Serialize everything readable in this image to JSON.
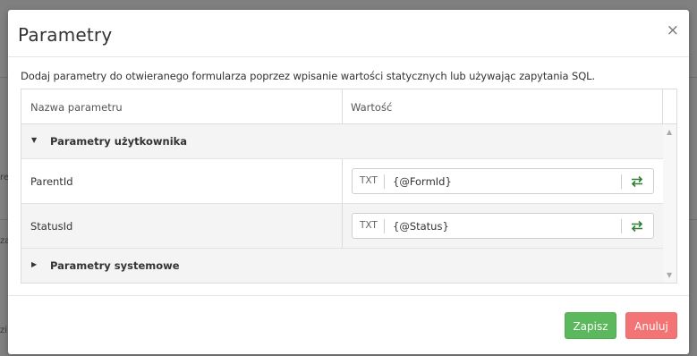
{
  "modal": {
    "title": "Parametry",
    "close_label": "×",
    "intro": "Dodaj parametry do otwieranego formularza poprzez wpisanie wartości statycznych lub używając zapytania SQL."
  },
  "table": {
    "headers": {
      "name": "Nazwa parametru",
      "value": "Wartość"
    },
    "groups": [
      {
        "label": "Parametry użytkownika",
        "expanded": true,
        "params": [
          {
            "name": "ParentId",
            "type": "TXT",
            "value": "{@FormId}"
          },
          {
            "name": "StatusId",
            "type": "TXT",
            "value": "{@Status}"
          }
        ]
      },
      {
        "label": "Parametry systemowe",
        "expanded": false,
        "params": []
      }
    ]
  },
  "footer": {
    "save_label": "Zapisz",
    "cancel_label": "Anuluj"
  },
  "colors": {
    "save": "#5cb85c",
    "cancel": "#f27474",
    "swap_icon": "#2e7d32"
  },
  "icons": {
    "close": "close-icon",
    "expanded": "caret-down-icon",
    "collapsed": "caret-right-icon",
    "swap": "swap-arrows-icon",
    "scroll_up": "scroll-up-icon",
    "scroll_down": "scroll-down-icon"
  }
}
